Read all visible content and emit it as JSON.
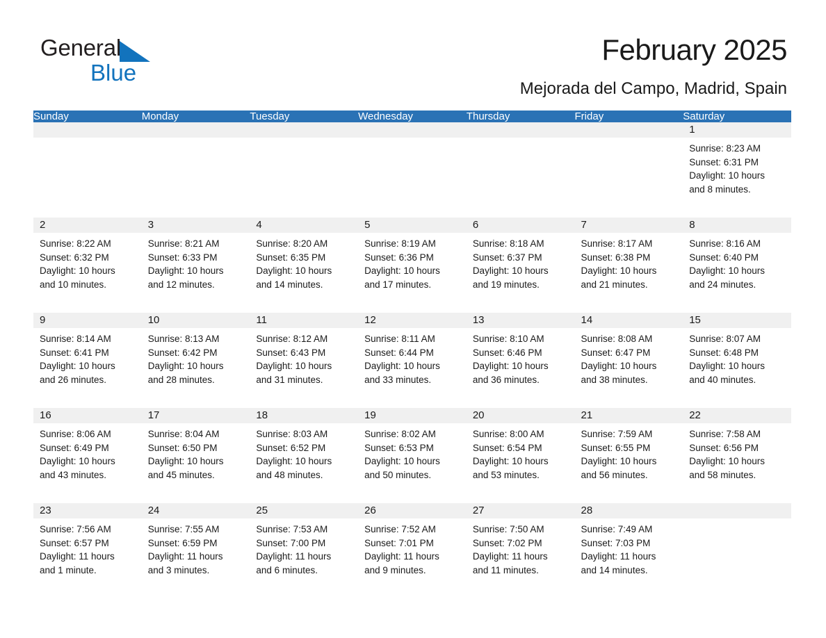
{
  "logo": {
    "word1": "General",
    "word2": "Blue",
    "triangle_color": "#1273bd"
  },
  "header": {
    "title": "February 2025",
    "subtitle": "Mejorada del Campo, Madrid, Spain",
    "accent_color": "#2a72b5",
    "band_color": "#f0f0f0"
  },
  "weekday_headers": [
    "Sunday",
    "Monday",
    "Tuesday",
    "Wednesday",
    "Thursday",
    "Friday",
    "Saturday"
  ],
  "labels": {
    "sunrise_prefix": "Sunrise:",
    "sunset_prefix": "Sunset:",
    "daylight_prefix": "Daylight:"
  },
  "weeks": [
    [
      {
        "day": "",
        "sunrise": "",
        "sunset": "",
        "daylight1": "",
        "daylight2": ""
      },
      {
        "day": "",
        "sunrise": "",
        "sunset": "",
        "daylight1": "",
        "daylight2": ""
      },
      {
        "day": "",
        "sunrise": "",
        "sunset": "",
        "daylight1": "",
        "daylight2": ""
      },
      {
        "day": "",
        "sunrise": "",
        "sunset": "",
        "daylight1": "",
        "daylight2": ""
      },
      {
        "day": "",
        "sunrise": "",
        "sunset": "",
        "daylight1": "",
        "daylight2": ""
      },
      {
        "day": "",
        "sunrise": "",
        "sunset": "",
        "daylight1": "",
        "daylight2": ""
      },
      {
        "day": "1",
        "sunrise": "Sunrise: 8:23 AM",
        "sunset": "Sunset: 6:31 PM",
        "daylight1": "Daylight: 10 hours",
        "daylight2": "and 8 minutes."
      }
    ],
    [
      {
        "day": "2",
        "sunrise": "Sunrise: 8:22 AM",
        "sunset": "Sunset: 6:32 PM",
        "daylight1": "Daylight: 10 hours",
        "daylight2": "and 10 minutes."
      },
      {
        "day": "3",
        "sunrise": "Sunrise: 8:21 AM",
        "sunset": "Sunset: 6:33 PM",
        "daylight1": "Daylight: 10 hours",
        "daylight2": "and 12 minutes."
      },
      {
        "day": "4",
        "sunrise": "Sunrise: 8:20 AM",
        "sunset": "Sunset: 6:35 PM",
        "daylight1": "Daylight: 10 hours",
        "daylight2": "and 14 minutes."
      },
      {
        "day": "5",
        "sunrise": "Sunrise: 8:19 AM",
        "sunset": "Sunset: 6:36 PM",
        "daylight1": "Daylight: 10 hours",
        "daylight2": "and 17 minutes."
      },
      {
        "day": "6",
        "sunrise": "Sunrise: 8:18 AM",
        "sunset": "Sunset: 6:37 PM",
        "daylight1": "Daylight: 10 hours",
        "daylight2": "and 19 minutes."
      },
      {
        "day": "7",
        "sunrise": "Sunrise: 8:17 AM",
        "sunset": "Sunset: 6:38 PM",
        "daylight1": "Daylight: 10 hours",
        "daylight2": "and 21 minutes."
      },
      {
        "day": "8",
        "sunrise": "Sunrise: 8:16 AM",
        "sunset": "Sunset: 6:40 PM",
        "daylight1": "Daylight: 10 hours",
        "daylight2": "and 24 minutes."
      }
    ],
    [
      {
        "day": "9",
        "sunrise": "Sunrise: 8:14 AM",
        "sunset": "Sunset: 6:41 PM",
        "daylight1": "Daylight: 10 hours",
        "daylight2": "and 26 minutes."
      },
      {
        "day": "10",
        "sunrise": "Sunrise: 8:13 AM",
        "sunset": "Sunset: 6:42 PM",
        "daylight1": "Daylight: 10 hours",
        "daylight2": "and 28 minutes."
      },
      {
        "day": "11",
        "sunrise": "Sunrise: 8:12 AM",
        "sunset": "Sunset: 6:43 PM",
        "daylight1": "Daylight: 10 hours",
        "daylight2": "and 31 minutes."
      },
      {
        "day": "12",
        "sunrise": "Sunrise: 8:11 AM",
        "sunset": "Sunset: 6:44 PM",
        "daylight1": "Daylight: 10 hours",
        "daylight2": "and 33 minutes."
      },
      {
        "day": "13",
        "sunrise": "Sunrise: 8:10 AM",
        "sunset": "Sunset: 6:46 PM",
        "daylight1": "Daylight: 10 hours",
        "daylight2": "and 36 minutes."
      },
      {
        "day": "14",
        "sunrise": "Sunrise: 8:08 AM",
        "sunset": "Sunset: 6:47 PM",
        "daylight1": "Daylight: 10 hours",
        "daylight2": "and 38 minutes."
      },
      {
        "day": "15",
        "sunrise": "Sunrise: 8:07 AM",
        "sunset": "Sunset: 6:48 PM",
        "daylight1": "Daylight: 10 hours",
        "daylight2": "and 40 minutes."
      }
    ],
    [
      {
        "day": "16",
        "sunrise": "Sunrise: 8:06 AM",
        "sunset": "Sunset: 6:49 PM",
        "daylight1": "Daylight: 10 hours",
        "daylight2": "and 43 minutes."
      },
      {
        "day": "17",
        "sunrise": "Sunrise: 8:04 AM",
        "sunset": "Sunset: 6:50 PM",
        "daylight1": "Daylight: 10 hours",
        "daylight2": "and 45 minutes."
      },
      {
        "day": "18",
        "sunrise": "Sunrise: 8:03 AM",
        "sunset": "Sunset: 6:52 PM",
        "daylight1": "Daylight: 10 hours",
        "daylight2": "and 48 minutes."
      },
      {
        "day": "19",
        "sunrise": "Sunrise: 8:02 AM",
        "sunset": "Sunset: 6:53 PM",
        "daylight1": "Daylight: 10 hours",
        "daylight2": "and 50 minutes."
      },
      {
        "day": "20",
        "sunrise": "Sunrise: 8:00 AM",
        "sunset": "Sunset: 6:54 PM",
        "daylight1": "Daylight: 10 hours",
        "daylight2": "and 53 minutes."
      },
      {
        "day": "21",
        "sunrise": "Sunrise: 7:59 AM",
        "sunset": "Sunset: 6:55 PM",
        "daylight1": "Daylight: 10 hours",
        "daylight2": "and 56 minutes."
      },
      {
        "day": "22",
        "sunrise": "Sunrise: 7:58 AM",
        "sunset": "Sunset: 6:56 PM",
        "daylight1": "Daylight: 10 hours",
        "daylight2": "and 58 minutes."
      }
    ],
    [
      {
        "day": "23",
        "sunrise": "Sunrise: 7:56 AM",
        "sunset": "Sunset: 6:57 PM",
        "daylight1": "Daylight: 11 hours",
        "daylight2": "and 1 minute."
      },
      {
        "day": "24",
        "sunrise": "Sunrise: 7:55 AM",
        "sunset": "Sunset: 6:59 PM",
        "daylight1": "Daylight: 11 hours",
        "daylight2": "and 3 minutes."
      },
      {
        "day": "25",
        "sunrise": "Sunrise: 7:53 AM",
        "sunset": "Sunset: 7:00 PM",
        "daylight1": "Daylight: 11 hours",
        "daylight2": "and 6 minutes."
      },
      {
        "day": "26",
        "sunrise": "Sunrise: 7:52 AM",
        "sunset": "Sunset: 7:01 PM",
        "daylight1": "Daylight: 11 hours",
        "daylight2": "and 9 minutes."
      },
      {
        "day": "27",
        "sunrise": "Sunrise: 7:50 AM",
        "sunset": "Sunset: 7:02 PM",
        "daylight1": "Daylight: 11 hours",
        "daylight2": "and 11 minutes."
      },
      {
        "day": "28",
        "sunrise": "Sunrise: 7:49 AM",
        "sunset": "Sunset: 7:03 PM",
        "daylight1": "Daylight: 11 hours",
        "daylight2": "and 14 minutes."
      },
      {
        "day": "",
        "sunrise": "",
        "sunset": "",
        "daylight1": "",
        "daylight2": ""
      }
    ]
  ]
}
